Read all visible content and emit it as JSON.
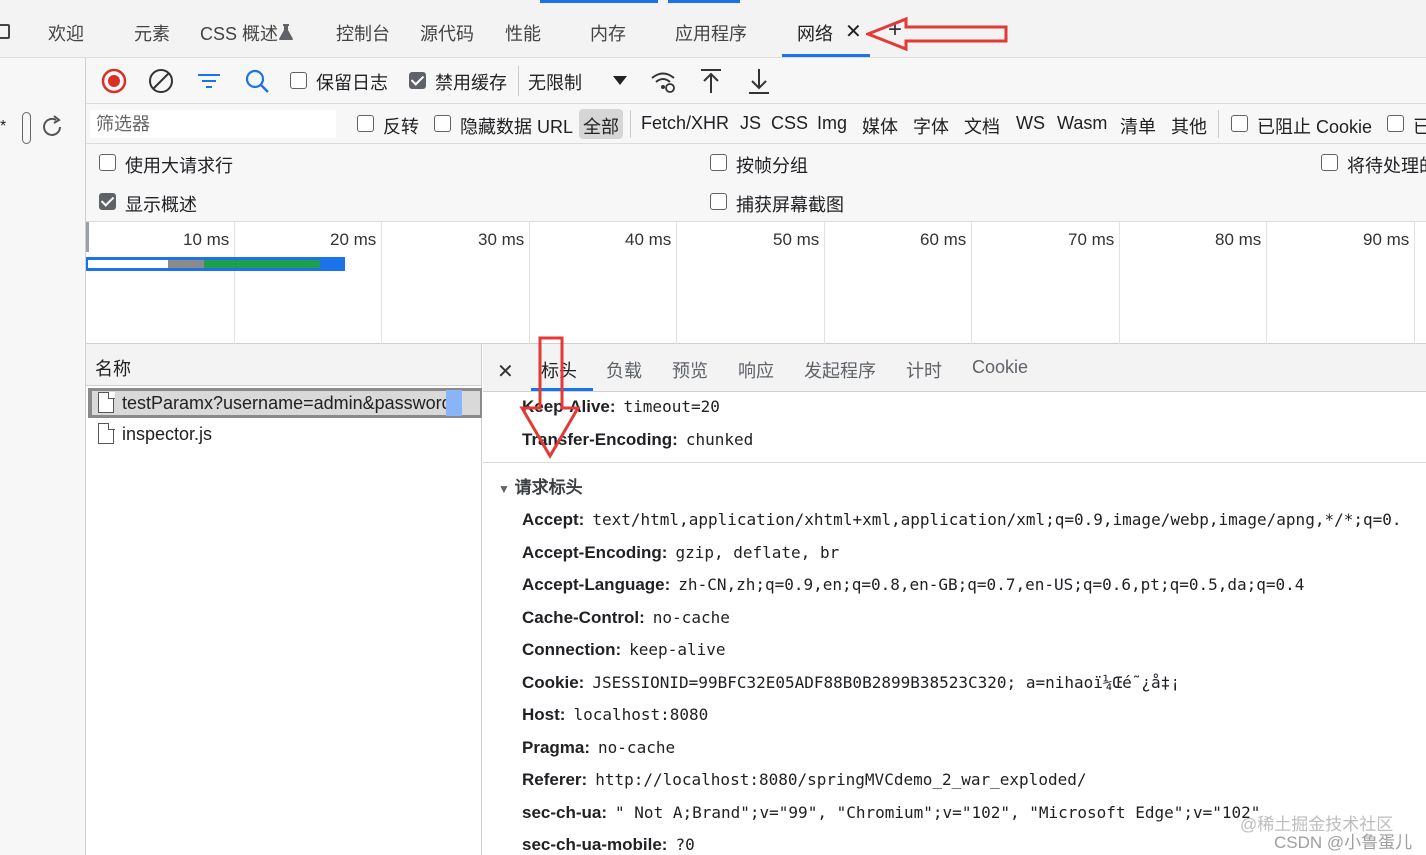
{
  "tabs": [
    {
      "label": "欢迎"
    },
    {
      "label": "元素"
    },
    {
      "label": "CSS 概述"
    },
    {
      "label": "控制台"
    },
    {
      "label": "源代码"
    },
    {
      "label": "性能"
    },
    {
      "label": "内存"
    },
    {
      "label": "应用程序"
    },
    {
      "label": "网络"
    }
  ],
  "active_tab": "网络",
  "toolbar": {
    "preserve_log": "保留日志",
    "disable_cache": "禁用缓存",
    "throttling": "无限制"
  },
  "filter": {
    "placeholder": "筛选器",
    "invert": "反转",
    "hide_data_urls": "隐藏数据 URL",
    "types": [
      "全部",
      "Fetch/XHR",
      "JS",
      "CSS",
      "Img",
      "媒体",
      "字体",
      "文档",
      "WS",
      "Wasm",
      "清单",
      "其他"
    ],
    "blocked_cookies": "已阻止 Cookie",
    "truncated_next": "已"
  },
  "options": {
    "large_rows": "使用大请求行",
    "group_by_frame": "按帧分组",
    "pending": "将待处理的",
    "show_overview": "显示概述",
    "capture_screenshots": "捕获屏幕截图"
  },
  "timeline": {
    "ticks": [
      "10 ms",
      "20 ms",
      "30 ms",
      "40 ms",
      "50 ms",
      "60 ms",
      "70 ms",
      "80 ms",
      "90 ms"
    ]
  },
  "request_list": {
    "header": "名称",
    "rows": [
      {
        "name": "testParamx?username=admin&password=…"
      },
      {
        "name": "inspector.js"
      }
    ]
  },
  "detail": {
    "tabs": [
      "标头",
      "负载",
      "预览",
      "响应",
      "发起程序",
      "计时",
      "Cookie"
    ],
    "response_headers_tail": [
      {
        "name": "Keep-Alive:",
        "value": "timeout=20"
      },
      {
        "name": "Transfer-Encoding:",
        "value": "chunked"
      }
    ],
    "request_section_title": "请求标头",
    "request_headers": [
      {
        "name": "Accept:",
        "value": "text/html,application/xhtml+xml,application/xml;q=0.9,image/webp,image/apng,*/*;q=0."
      },
      {
        "name": "Accept-Encoding:",
        "value": "gzip, deflate, br"
      },
      {
        "name": "Accept-Language:",
        "value": "zh-CN,zh;q=0.9,en;q=0.8,en-GB;q=0.7,en-US;q=0.6,pt;q=0.5,da;q=0.4"
      },
      {
        "name": "Cache-Control:",
        "value": "no-cache"
      },
      {
        "name": "Connection:",
        "value": "keep-alive"
      },
      {
        "name": "Cookie:",
        "value": "JSESSIONID=99BFC32E05ADF88B0B2899B38523C320; a=nihaoï¼Œé˜¿å‡¡"
      },
      {
        "name": "Host:",
        "value": "localhost:8080"
      },
      {
        "name": "Pragma:",
        "value": "no-cache"
      },
      {
        "name": "Referer:",
        "value": "http://localhost:8080/springMVCdemo_2_war_exploded/"
      },
      {
        "name": "sec-ch-ua:",
        "value": "\" Not A;Brand\";v=\"99\", \"Chromium\";v=\"102\", \"Microsoft Edge\";v=\"102\""
      },
      {
        "name": "sec-ch-ua-mobile:",
        "value": "?0"
      }
    ]
  },
  "watermark": {
    "line1": "@稀土掘金技术社区",
    "line2": "CSDN @小鲁蛋儿"
  },
  "colors": {
    "accent": "#1a73e8",
    "annotation_red": "#e53935",
    "record_red": "#d93025"
  }
}
